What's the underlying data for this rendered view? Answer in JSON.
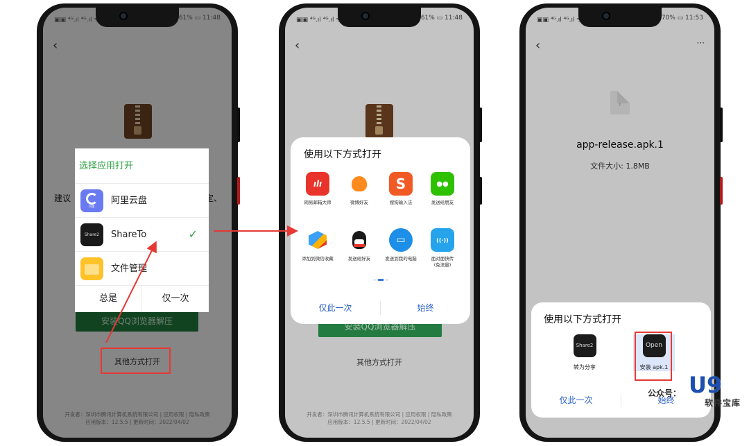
{
  "phone1": {
    "status_left": "▣▣ ⁴ᴳ.ıl ⁴ᴳ.ıl ᯤ",
    "status_right": "✱ 61% ▭ 11:48",
    "back": "‹",
    "bg_text_left": "建议",
    "bg_text_right": "定、",
    "install_btn": "安装QQ浏览器解压",
    "other_open": "其他方式打开",
    "footer_line1": "开发者：深圳市腾讯计算机系统有限公司 | 应用权限 | 隐私政策",
    "footer_line2": "应用版本：12.5.5 | 更新时间：2022/04/02",
    "dialog": {
      "title": "选择应用打开",
      "items": [
        {
          "label": "阿里云盘",
          "icon": "aliyun-drive-icon",
          "sub": "阿里"
        },
        {
          "label": "ShareTo",
          "icon": "shareto-icon",
          "sub": "Share2"
        },
        {
          "label": "文件管理",
          "icon": "file-manager-icon",
          "sub": ""
        }
      ],
      "check": "✓",
      "always": "总是",
      "once": "仅一次"
    }
  },
  "phone2": {
    "status_left": "▣▣ ⁴ᴳ.ıl ⁴ᴳ.ıl ᯤ",
    "status_right": "✱ 61% ▭ 11:48",
    "back": "‹",
    "install_btn": "安装QQ浏览器解压",
    "other_open": "其他方式打开",
    "footer_line1": "开发者：深圳市腾讯计算机系统有限公司 | 应用权限 | 隐私政策",
    "footer_line2": "应用版本：12.5.5 | 更新时间：2022/04/02",
    "sheet": {
      "title": "使用以下方式打开",
      "apps": [
        {
          "label": "网易邮箱大师",
          "icon": "netease-mail-icon",
          "glyph": "mail",
          "color": "#e8342a"
        },
        {
          "label": "微博好友",
          "icon": "weibo-friend-icon",
          "glyph": "●",
          "color": "#ff8a1e"
        },
        {
          "label": "搜狗输入法",
          "icon": "sogou-input-icon",
          "glyph": "S",
          "color": "#f25a25"
        },
        {
          "label": "发送给朋友",
          "icon": "wechat-icon",
          "glyph": "●●",
          "color": "#2dc100"
        },
        {
          "label": "添加到微信收藏",
          "icon": "wechat-favorite-icon",
          "glyph": "◆",
          "color": "#3aa0f5"
        },
        {
          "label": "发送给好友",
          "icon": "qq-icon",
          "glyph": "●",
          "color": "#1a1a1a"
        },
        {
          "label": "发送到我的电脑",
          "icon": "my-computer-icon",
          "glyph": "▭",
          "color": "#1d8fe8"
        },
        {
          "label": "面对面快传\n(免流量)",
          "icon": "face-to-face-icon",
          "glyph": "((·))",
          "color": "#25a4ec"
        }
      ],
      "once": "仅此一次",
      "always": "始终"
    }
  },
  "phone3": {
    "status_left": "▣▣ ⁴ᴳ.ıl ⁴ᴳ.ıl ᯤ",
    "status_right": "70% ▭ 11:53",
    "back": "‹",
    "more": "···",
    "file_icon_glyph": "?",
    "file_name": "app-release.apk.1",
    "file_size": "文件大小: 1.8MB",
    "sheet": {
      "title": "使用以下方式打开",
      "apps": [
        {
          "label": "转为分享",
          "icon": "share2-icon",
          "glyph": "Share2"
        },
        {
          "label": "安装 apk.1",
          "icon": "open-apk-icon",
          "glyph": "Open"
        }
      ],
      "once": "仅此一次",
      "always": "始终"
    }
  },
  "watermark": {
    "prefix": "公众号：",
    "brand": "U9",
    "site": "软件宝库"
  },
  "colors": {
    "highlight_red": "#e53935",
    "green": "#2ea043",
    "blue_action": "#2a62c9"
  }
}
